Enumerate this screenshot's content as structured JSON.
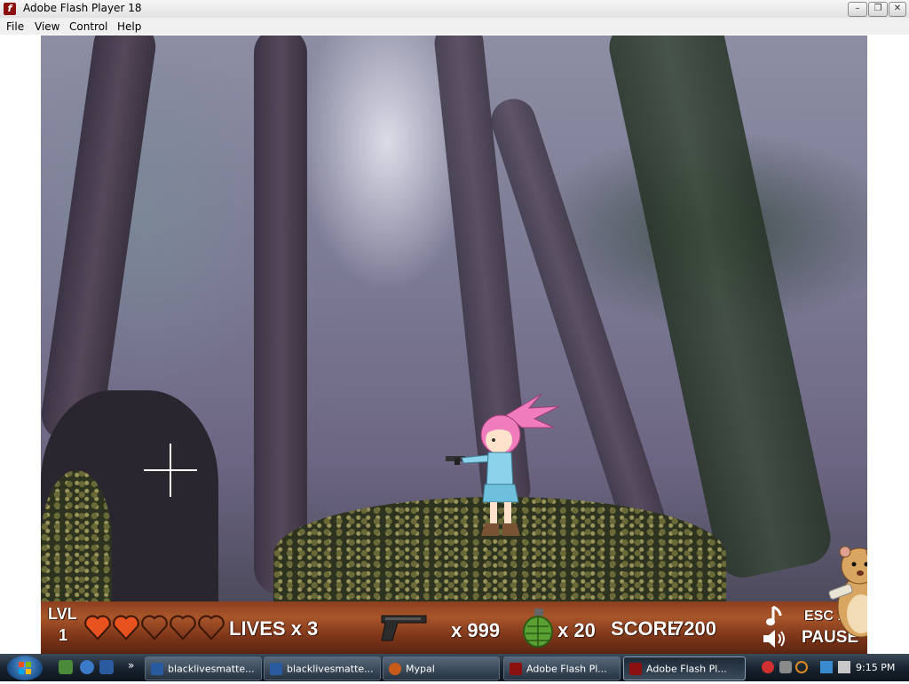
{
  "window": {
    "title": "Adobe Flash Player 18",
    "min": "–",
    "max": "❐",
    "close": "✕"
  },
  "menu": [
    "File",
    "View",
    "Control",
    "Help"
  ],
  "hud": {
    "level_label": "LVL",
    "level": "1",
    "hearts_total": 5,
    "hearts_full": 2,
    "lives_text": "LIVES x 3",
    "ammo_text": "x 999",
    "grenades_text": "x 20",
    "score_label": "SCORE",
    "score": "7200",
    "esc_text": "ESC 1",
    "pause_text": "PAUSE"
  },
  "taskbar": {
    "buttons": [
      {
        "label": "blacklivesmatte...",
        "active": false
      },
      {
        "label": "blacklivesmatte...",
        "active": false
      },
      {
        "label": "Mypal",
        "active": false
      },
      {
        "label": "Adobe Flash Pl...",
        "active": false
      },
      {
        "label": "Adobe Flash Pl...",
        "active": true
      }
    ],
    "chevron": "»",
    "clock": "9:15 PM"
  },
  "colors": {
    "hud_wood": "#8c3f1e",
    "heart_full": "#e8521e",
    "hair": "#f07bbd"
  }
}
